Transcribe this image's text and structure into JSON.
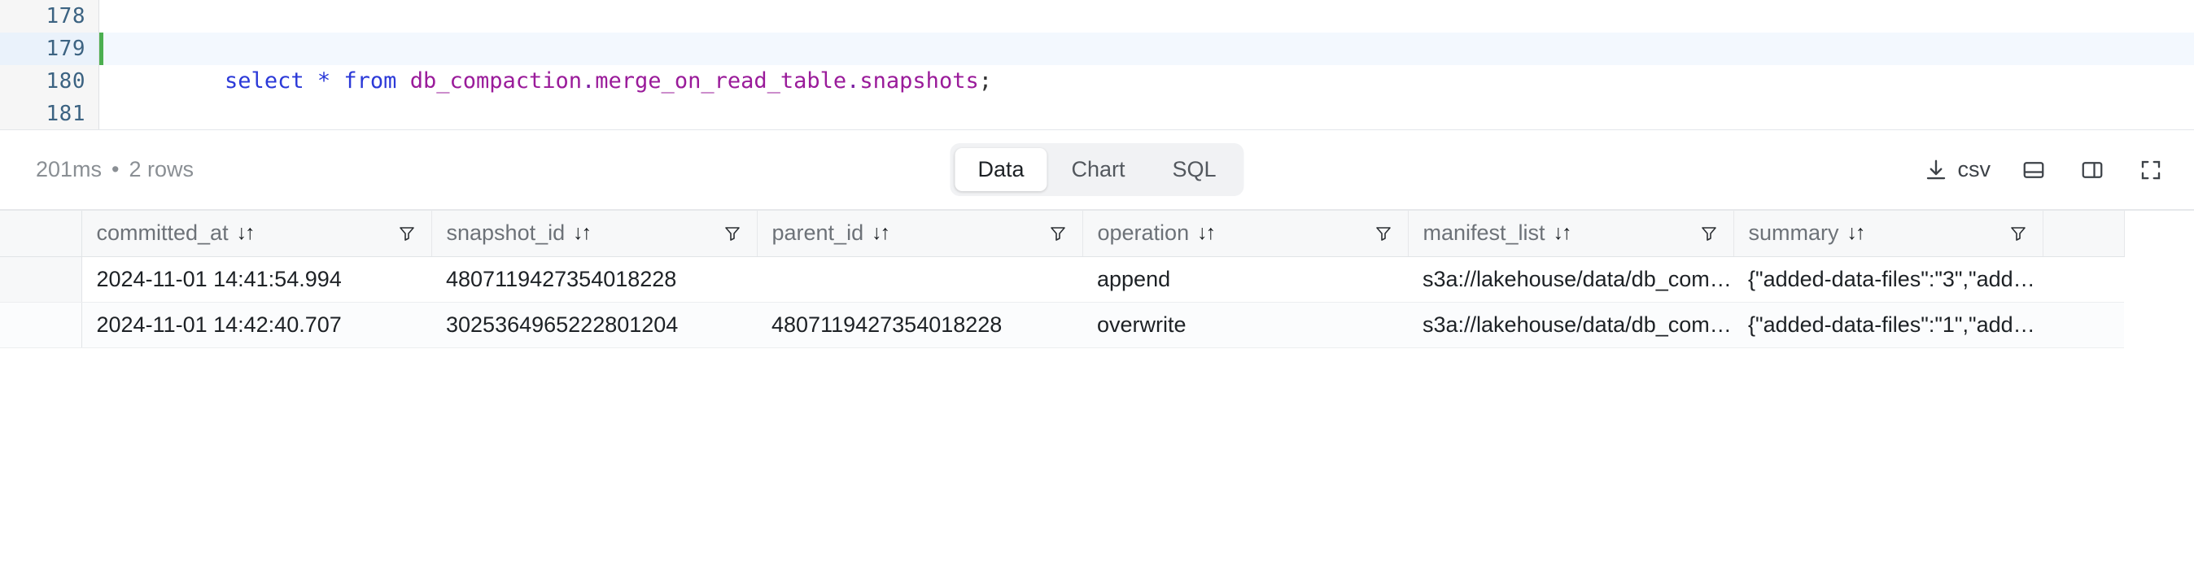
{
  "editor": {
    "lines": [
      {
        "number": "178",
        "text": "",
        "active": false
      },
      {
        "number": "179",
        "text": "select * from db_compaction.merge_on_read_table.snapshots;",
        "active": true
      },
      {
        "number": "180",
        "text": "",
        "active": false
      },
      {
        "number": "181",
        "text": "",
        "active": false
      }
    ],
    "sql_tokens": {
      "kw_select": "select",
      "star": "*",
      "kw_from": "from",
      "schema": "db_compaction",
      "dot1": ".",
      "table": "merge_on_read_table",
      "dot2": ".",
      "meta_table": "snapshots",
      "semicolon": ";"
    },
    "caret_line": "179"
  },
  "toolbar": {
    "duration": "201ms",
    "separator": "•",
    "rows_label": "2 rows",
    "tabs": [
      {
        "label": "Data",
        "active": true
      },
      {
        "label": "Chart",
        "active": false
      },
      {
        "label": "SQL",
        "active": false
      }
    ],
    "csv_label": "csv",
    "icons": {
      "download": "download-icon",
      "csv": "csv-export-button",
      "panel_bottom": "panel-bottom-icon",
      "panel_right": "panel-right-icon",
      "fullscreen": "fullscreen-icon"
    }
  },
  "table": {
    "sort_glyph": "↓↑",
    "columns": [
      {
        "key": "committed_at",
        "label": "committed_at"
      },
      {
        "key": "snapshot_id",
        "label": "snapshot_id"
      },
      {
        "key": "parent_id",
        "label": "parent_id"
      },
      {
        "key": "operation",
        "label": "operation"
      },
      {
        "key": "manifest_list",
        "label": "manifest_list"
      },
      {
        "key": "summary",
        "label": "summary"
      }
    ],
    "rows": [
      {
        "committed_at": "2024-11-01 14:41:54.994",
        "snapshot_id": "4807119427354018228",
        "parent_id": "",
        "operation": "append",
        "manifest_list": "s3a://lakehouse/data/db_com…",
        "summary": "{\"added-data-files\":\"3\",\"add…"
      },
      {
        "committed_at": "2024-11-01 14:42:40.707",
        "snapshot_id": "3025364965222801204",
        "parent_id": "4807119427354018228",
        "operation": "overwrite",
        "manifest_list": "s3a://lakehouse/data/db_com…",
        "summary": "{\"added-data-files\":\"1\",\"add…"
      }
    ]
  },
  "colors": {
    "keyword": "#2b39d8",
    "identifier": "#9a1b9a",
    "caret": "#4caf50",
    "active_line_bg": "#f3f8fe",
    "gutter_bg": "#f6f6f6"
  }
}
